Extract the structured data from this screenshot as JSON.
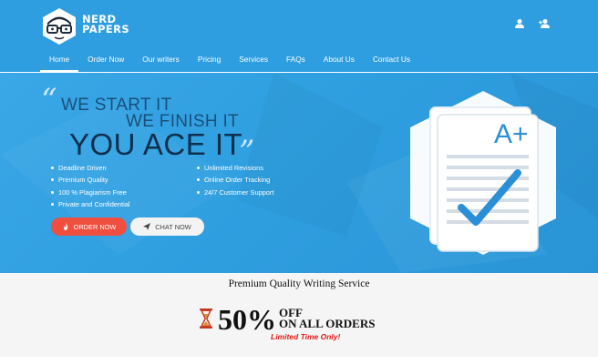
{
  "brand": {
    "logo_line1": "NERD",
    "logo_line2": "PAPERS",
    "icons": [
      "nerd-mascot-icon",
      "user-icon",
      "add-user-icon"
    ]
  },
  "nav": {
    "items": [
      {
        "label": "Home",
        "active": true
      },
      {
        "label": "Order Now"
      },
      {
        "label": "Our writers"
      },
      {
        "label": "Pricing"
      },
      {
        "label": "Services"
      },
      {
        "label": "FAQs"
      },
      {
        "label": "About Us"
      },
      {
        "label": "Contact Us"
      }
    ]
  },
  "hero": {
    "line1": "WE START IT",
    "line2": "WE FINISH IT",
    "line3": "YOU ACE IT",
    "features_left": [
      "Deadline Driven",
      "Premium Quality",
      "100 % Plagiarism Free",
      "Private and Confidential"
    ],
    "features_right": [
      "Unlimited Revisions",
      "Online Order Tracking",
      "24/7 Customer Support"
    ],
    "order_button": "ORDER NOW",
    "chat_button": "CHAT NOW",
    "grade": "A+"
  },
  "promo": {
    "title": "Premium Quality Writing Service",
    "percent": "50%",
    "off": "OFF",
    "all_orders": "ON ALL ORDERS",
    "limited": "Limited Time Only!"
  },
  "colors": {
    "header_blue": "#2e9ee0",
    "hero_blue": "#3aa7e6",
    "order_red": "#f04e3e",
    "limited_red": "#e21b1b",
    "check_blue": "#2a8fd6"
  }
}
